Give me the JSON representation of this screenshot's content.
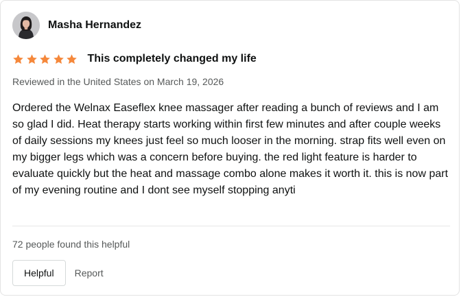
{
  "reviewer": {
    "name": "Masha Hernandez"
  },
  "review": {
    "rating": 5,
    "rating_max": 5,
    "star_color": "#f5883b",
    "headline": "This completely changed my life",
    "meta": "Reviewed in the United States on March 19, 2026",
    "body": "Ordered the Welnax Easeflex knee massager after reading a bunch of reviews and I am so glad I did. Heat therapy starts working within first few minutes and after couple weeks of daily sessions my knees just feel so much looser in the morning. strap fits well even on my bigger legs which was a concern before buying. the red light feature is harder to evaluate quickly but the heat and massage combo alone makes it worth it. this is now part of my evening routine and I dont see myself stopping anyti"
  },
  "footer": {
    "helpful_count": "72 people found this helpful",
    "helpful_button": "Helpful",
    "report_link": "Report"
  }
}
